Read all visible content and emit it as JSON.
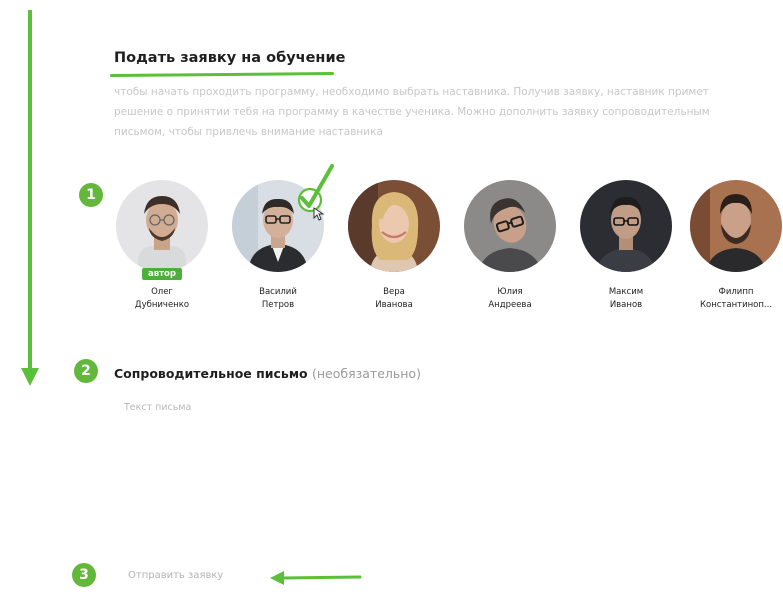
{
  "form": {
    "title": "Подать заявку на обучение",
    "description": "чтобы начать проходить программу, необходимо выбрать наставника. Получив заявку, наставник примет решение о принятии тебя на программу в качестве ученика. Можно дополнить заявку сопроводительным письмом, чтобы привлечь внимание наставника"
  },
  "steps": {
    "one": "1",
    "two": "2",
    "three": "3"
  },
  "mentors": [
    {
      "first": "Олег",
      "last": "Дубниченко",
      "badge": "автор",
      "selected": false
    },
    {
      "first": "Василий",
      "last": "Петров",
      "badge": "",
      "selected": true
    },
    {
      "first": "Вера",
      "last": "Иванова",
      "badge": "",
      "selected": false
    },
    {
      "first": "Юлия",
      "last": "Андреева",
      "badge": "",
      "selected": false
    },
    {
      "first": "Максим",
      "last": "Иванов",
      "badge": "",
      "selected": false
    },
    {
      "first": "Филипп",
      "last": "Константиноп...",
      "badge": "",
      "selected": false
    }
  ],
  "cover_letter": {
    "title": "Сопроводительное письмо",
    "optional": "(необязательно)",
    "placeholder": "Текст письма"
  },
  "submit": {
    "label": "Отправить заявку"
  },
  "colors": {
    "accent": "#5cbf3a",
    "badge": "#63b83c",
    "muted": "#c7c7c7"
  }
}
